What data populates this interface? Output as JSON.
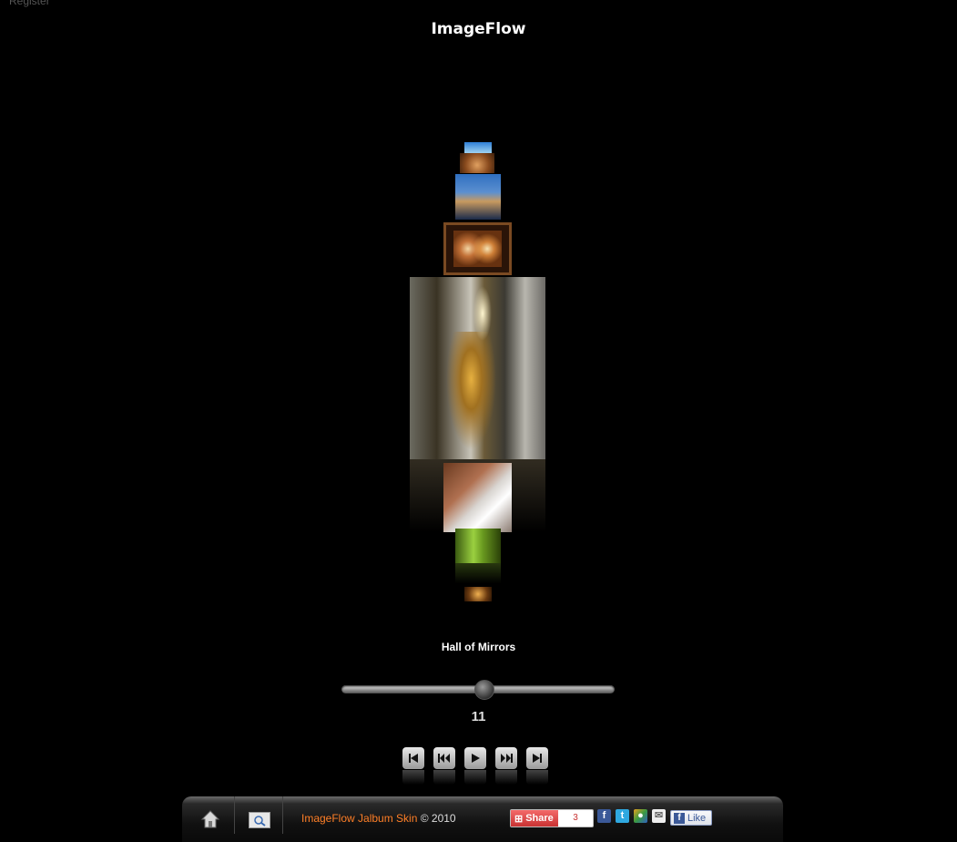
{
  "header": {
    "register_label": "Register",
    "title": "ImageFlow"
  },
  "gallery": {
    "caption": "Hall of Mirrors",
    "slider_position": 0.52,
    "counter": "11",
    "thumbnails": [
      {
        "name": "blue-sky-thumb"
      },
      {
        "name": "astronomical-clock-thumb"
      },
      {
        "name": "venice-canal-thumb"
      },
      {
        "name": "masks-window-thumb"
      },
      {
        "name": "hall-of-mirrors-image"
      },
      {
        "name": "eiffel-tower-thumb"
      },
      {
        "name": "green-leaves-thumb"
      },
      {
        "name": "sunset-thumb"
      },
      {
        "name": "still-life-thumb"
      }
    ]
  },
  "controls": [
    {
      "name": "first-button",
      "icon": "first-icon"
    },
    {
      "name": "previous-button",
      "icon": "rewind-icon"
    },
    {
      "name": "play-button",
      "icon": "play-icon"
    },
    {
      "name": "next-button",
      "icon": "fast-forward-icon"
    },
    {
      "name": "last-button",
      "icon": "last-icon"
    }
  ],
  "footer": {
    "credits_link": "ImageFlow Jalbum Skin",
    "credits_text": "© 2010",
    "share_label": "Share",
    "share_count": "3",
    "like_label": "Like",
    "accent_color": "#ff7f27"
  }
}
